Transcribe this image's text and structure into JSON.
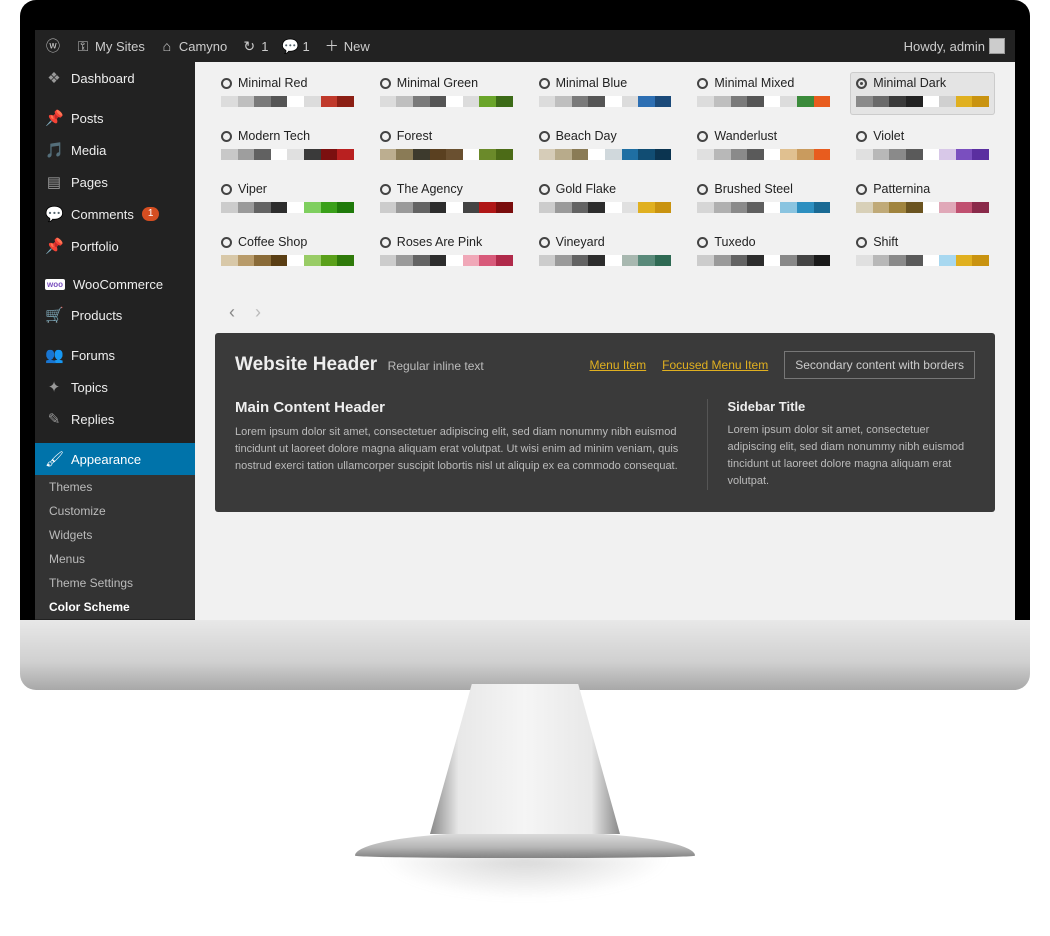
{
  "adminbar": {
    "mysites": "My Sites",
    "sitename": "Camyno",
    "updates": "1",
    "comments": "1",
    "new": "New",
    "howdy": "Howdy, admin"
  },
  "sidebar": {
    "items": [
      {
        "icon": "dashboard",
        "label": "Dashboard"
      },
      {
        "sep": true
      },
      {
        "icon": "pin",
        "label": "Posts"
      },
      {
        "icon": "media",
        "label": "Media"
      },
      {
        "icon": "page",
        "label": "Pages"
      },
      {
        "icon": "comment",
        "label": "Comments",
        "badge": "1"
      },
      {
        "icon": "pin",
        "label": "Portfolio"
      },
      {
        "sep": true
      },
      {
        "icon": "woo",
        "label": "WooCommerce"
      },
      {
        "icon": "cart",
        "label": "Products"
      },
      {
        "sep": true
      },
      {
        "icon": "forum",
        "label": "Forums"
      },
      {
        "icon": "topic",
        "label": "Topics"
      },
      {
        "icon": "reply",
        "label": "Replies"
      },
      {
        "sep": true
      },
      {
        "icon": "brush",
        "label": "Appearance",
        "active": true
      }
    ],
    "submenu": [
      {
        "label": "Themes"
      },
      {
        "label": "Customize"
      },
      {
        "label": "Widgets"
      },
      {
        "label": "Menus"
      },
      {
        "label": "Theme Settings"
      },
      {
        "label": "Color Scheme",
        "current": true
      }
    ]
  },
  "schemes": [
    {
      "name": "Minimal Red",
      "colors": [
        "#dcdcdc",
        "#bfbfbf",
        "#7a7a7a",
        "#555",
        "#ffffff",
        "#dcdcdc",
        "#c0392b",
        "#8c1f14"
      ]
    },
    {
      "name": "Minimal Green",
      "colors": [
        "#dcdcdc",
        "#bfbfbf",
        "#7a7a7a",
        "#555",
        "#ffffff",
        "#dcdcdc",
        "#6aa52a",
        "#3c6b17"
      ]
    },
    {
      "name": "Minimal Blue",
      "colors": [
        "#dcdcdc",
        "#bfbfbf",
        "#7a7a7a",
        "#555",
        "#ffffff",
        "#dcdcdc",
        "#2d6fb3",
        "#1b4a7a"
      ]
    },
    {
      "name": "Minimal Mixed",
      "colors": [
        "#dcdcdc",
        "#bfbfbf",
        "#7a7a7a",
        "#555",
        "#ffffff",
        "#dcdcdc",
        "#3b8b3b",
        "#e85c1e"
      ]
    },
    {
      "name": "Minimal Dark",
      "selected": true,
      "colors": [
        "#8a8a8a",
        "#6a6a6a",
        "#3a3a3a",
        "#222",
        "#ffffff",
        "#d0d0d0",
        "#e0b020",
        "#c99310"
      ]
    },
    {
      "name": "Modern Tech",
      "colors": [
        "#c8c8c8",
        "#9e9e9e",
        "#616161",
        "#ffffff",
        "#e0e0e0",
        "#3a3a3a",
        "#7b1010",
        "#b92020"
      ]
    },
    {
      "name": "Forest",
      "colors": [
        "#bcae90",
        "#8a7b56",
        "#3d3a2d",
        "#5a4020",
        "#6a5030",
        "#ffffff",
        "#6b8a2a",
        "#4c6b17"
      ]
    },
    {
      "name": "Beach Day",
      "colors": [
        "#d6ccb8",
        "#b8ab8b",
        "#8a7b56",
        "#ffffff",
        "#d0d8dc",
        "#1f6fa3",
        "#114d73",
        "#0b3450"
      ]
    },
    {
      "name": "Wanderlust",
      "colors": [
        "#e0e0e0",
        "#b8b8b8",
        "#8a8a8a",
        "#5a5a5a",
        "#ffffff",
        "#e0c090",
        "#c99b5e",
        "#e85c1e"
      ]
    },
    {
      "name": "Violet",
      "colors": [
        "#e0e0e0",
        "#b8b8b8",
        "#8a8a8a",
        "#5a5a5a",
        "#ffffff",
        "#d8c8e8",
        "#7a4fbf",
        "#5a2fa0"
      ]
    },
    {
      "name": "Viper",
      "colors": [
        "#cccccc",
        "#9a9a9a",
        "#636363",
        "#2d2d2d",
        "#ffffff",
        "#7fcf5f",
        "#3aa01a",
        "#1f7a0a"
      ]
    },
    {
      "name": "The Agency",
      "colors": [
        "#cccccc",
        "#9a9a9a",
        "#636363",
        "#2d2d2d",
        "#ffffff",
        "#444444",
        "#b01717",
        "#7a0d0d"
      ]
    },
    {
      "name": "Gold Flake",
      "colors": [
        "#cccccc",
        "#9a9a9a",
        "#636363",
        "#2d2d2d",
        "#ffffff",
        "#e0e0e0",
        "#e0b020",
        "#c99310"
      ]
    },
    {
      "name": "Brushed Steel",
      "colors": [
        "#d6d6d6",
        "#b0b0b0",
        "#8a8a8a",
        "#5f5f5f",
        "#ffffff",
        "#8ac4e0",
        "#2d8fc0",
        "#1a6a94"
      ]
    },
    {
      "name": "Patternina",
      "colors": [
        "#d8d0b8",
        "#c0aa78",
        "#a0843e",
        "#6b5420",
        "#ffffff",
        "#e0a8b8",
        "#c05070",
        "#8a2a4a"
      ]
    },
    {
      "name": "Coffee Shop",
      "colors": [
        "#d8c8a8",
        "#b89b6a",
        "#8a6b38",
        "#5a3e14",
        "#ffffff",
        "#99cc66",
        "#5aa01a",
        "#2f7a0a"
      ]
    },
    {
      "name": "Roses Are Pink",
      "colors": [
        "#cccccc",
        "#9a9a9a",
        "#636363",
        "#2d2d2d",
        "#ffffff",
        "#f0a8b8",
        "#d85a7a",
        "#b02a4a"
      ]
    },
    {
      "name": "Vineyard",
      "colors": [
        "#cccccc",
        "#9a9a9a",
        "#636363",
        "#2d2d2d",
        "#ffffff",
        "#a8b8b0",
        "#5a8a7a",
        "#2f6a54"
      ]
    },
    {
      "name": "Tuxedo",
      "colors": [
        "#cccccc",
        "#9a9a9a",
        "#636363",
        "#2d2d2d",
        "#ffffff",
        "#888888",
        "#444444",
        "#1a1a1a"
      ]
    },
    {
      "name": "Shift",
      "colors": [
        "#e0e0e0",
        "#b8b8b8",
        "#8a8a8a",
        "#5a5a5a",
        "#ffffff",
        "#a8d8f0",
        "#e0b020",
        "#c99310"
      ]
    }
  ],
  "preview": {
    "header": "Website Header",
    "header_sub": "Regular inline text",
    "menu_item": "Menu Item",
    "focused_menu": "Focused Menu Item",
    "secondary": "Secondary content with borders",
    "main_header": "Main Content Header",
    "main_body": "Lorem ipsum dolor sit amet, consectetuer adipiscing elit, sed diam nonummy nibh euismod tincidunt ut laoreet dolore magna aliquam erat volutpat. Ut wisi enim ad minim veniam, quis nostrud exerci tation ullamcorper suscipit lobortis nisl ut aliquip ex ea commodo consequat.",
    "sidebar_title": "Sidebar Title",
    "sidebar_body": "Lorem ipsum dolor sit amet, consectetuer adipiscing elit, sed diam nonummy nibh euismod tincidunt ut laoreet dolore magna aliquam erat volutpat."
  }
}
